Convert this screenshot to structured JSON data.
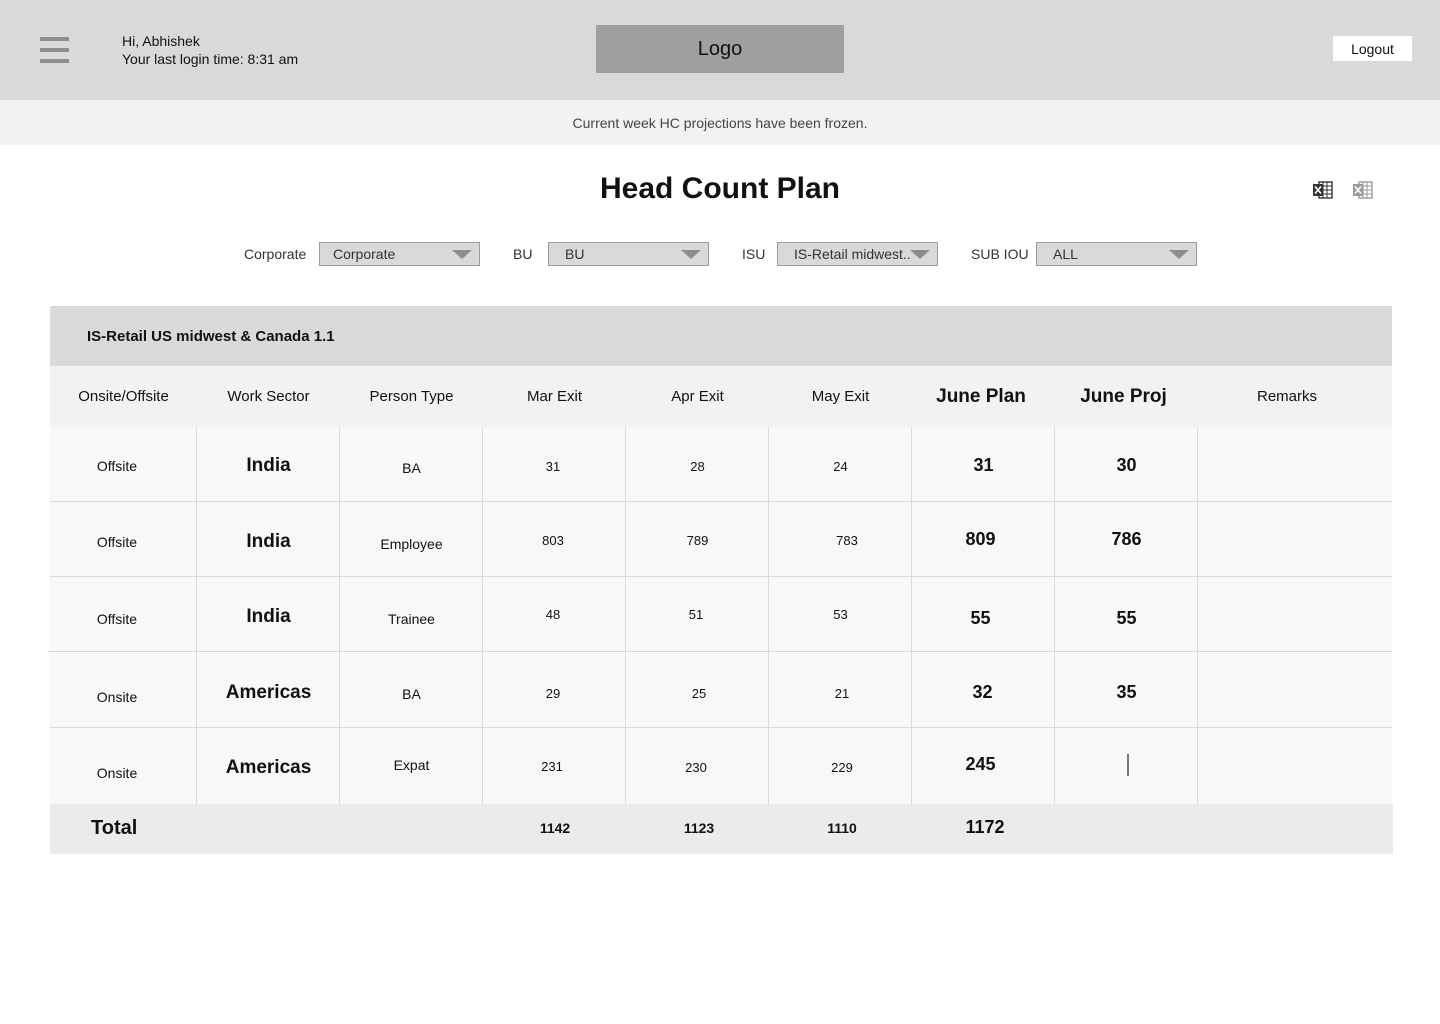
{
  "header": {
    "greeting": "Hi, Abhishek",
    "last_login": "Your last login time: 8:31 am",
    "logo": "Logo",
    "logout_label": "Logout"
  },
  "notice": "Current week HC projections have been frozen.",
  "page_title": "Head Count Plan",
  "icons": [
    "hamburger-menu-icon",
    "excel-export-icon",
    "excel-export-disabled-icon"
  ],
  "filters": [
    {
      "label": "Corporate",
      "value": "Corporate"
    },
    {
      "label": "BU",
      "value": "BU"
    },
    {
      "label": "ISU",
      "value": "IS-Retail midwest.."
    },
    {
      "label": "SUB IOU",
      "value": "ALL"
    }
  ],
  "table": {
    "group_title": "IS-Retail US midwest & Canada 1.1",
    "columns": [
      "Onsite/Offsite",
      "Work Sector",
      "Person Type",
      "Mar Exit",
      "Apr Exit",
      "May Exit",
      "June Plan",
      "June Proj",
      "Remarks"
    ],
    "rows": [
      {
        "location": "Offsite",
        "sector": "India",
        "person_type": "BA",
        "mar": "31",
        "apr": "28",
        "may": "24",
        "june_plan": "31",
        "june_proj": "30",
        "remarks": ""
      },
      {
        "location": "Offsite",
        "sector": "India",
        "person_type": "Employee",
        "mar": "803",
        "apr": "789",
        "may": "783",
        "june_plan": "809",
        "june_proj": "786",
        "remarks": ""
      },
      {
        "location": "Offsite",
        "sector": "India",
        "person_type": "Trainee",
        "mar": "48",
        "apr": "51",
        "may": "53",
        "june_plan": "55",
        "june_proj": "55",
        "remarks": ""
      },
      {
        "location": "Onsite",
        "sector": "Americas",
        "person_type": "BA",
        "mar": "29",
        "apr": "25",
        "may": "21",
        "june_plan": "32",
        "june_proj": "35",
        "remarks": ""
      },
      {
        "location": "Onsite",
        "sector": "Americas",
        "person_type": "Expat",
        "mar": "231",
        "apr": "230",
        "may": "229",
        "june_plan": "245",
        "june_proj": "",
        "remarks": ""
      }
    ],
    "total": {
      "label": "Total",
      "mar": "1142",
      "apr": "1123",
      "may": "1110",
      "june_plan": "1172"
    }
  },
  "colors": {
    "header_bg": "#d9d9d9",
    "logo_bg": "#9f9f9f",
    "notice_bg": "#f2f2f2",
    "select_bg": "#d9d9d9",
    "excel_icon_active": "#333333",
    "excel_icon_disabled": "#9a9a9a"
  }
}
